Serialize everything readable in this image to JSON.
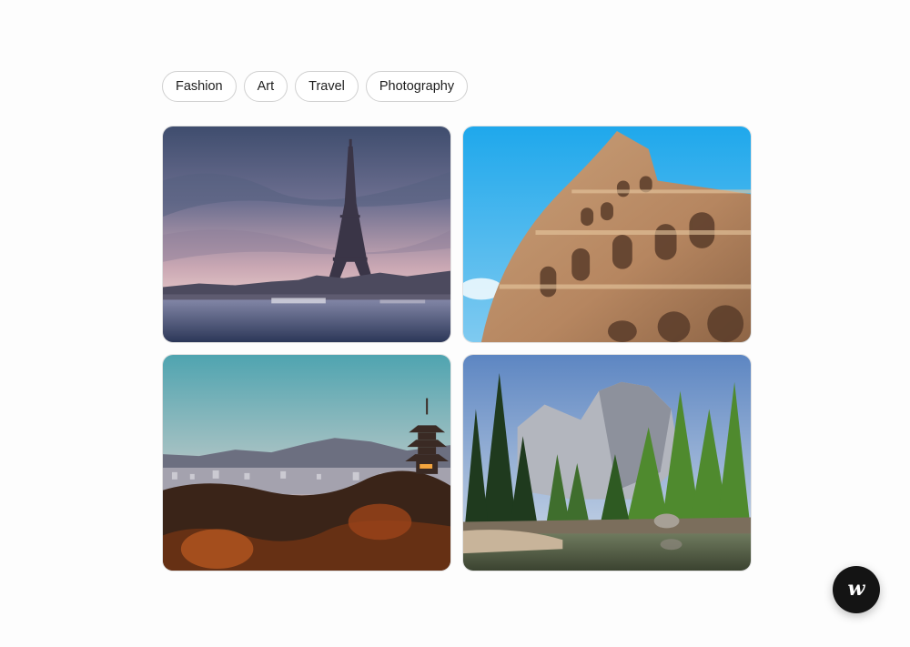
{
  "tags": [
    {
      "label": "Fashion"
    },
    {
      "label": "Art"
    },
    {
      "label": "Travel"
    },
    {
      "label": "Photography"
    }
  ],
  "gallery": [
    {
      "icon": "eiffel-tower-photo"
    },
    {
      "icon": "colosseum-photo"
    },
    {
      "icon": "pagoda-city-photo"
    },
    {
      "icon": "yosemite-forest-photo"
    }
  ],
  "fab": {
    "glyph": "w",
    "icon": "w-logo-icon"
  },
  "colors": {
    "background": "#fdfdfd",
    "tag_border": "#d0d0d0",
    "fab": "#141414"
  }
}
